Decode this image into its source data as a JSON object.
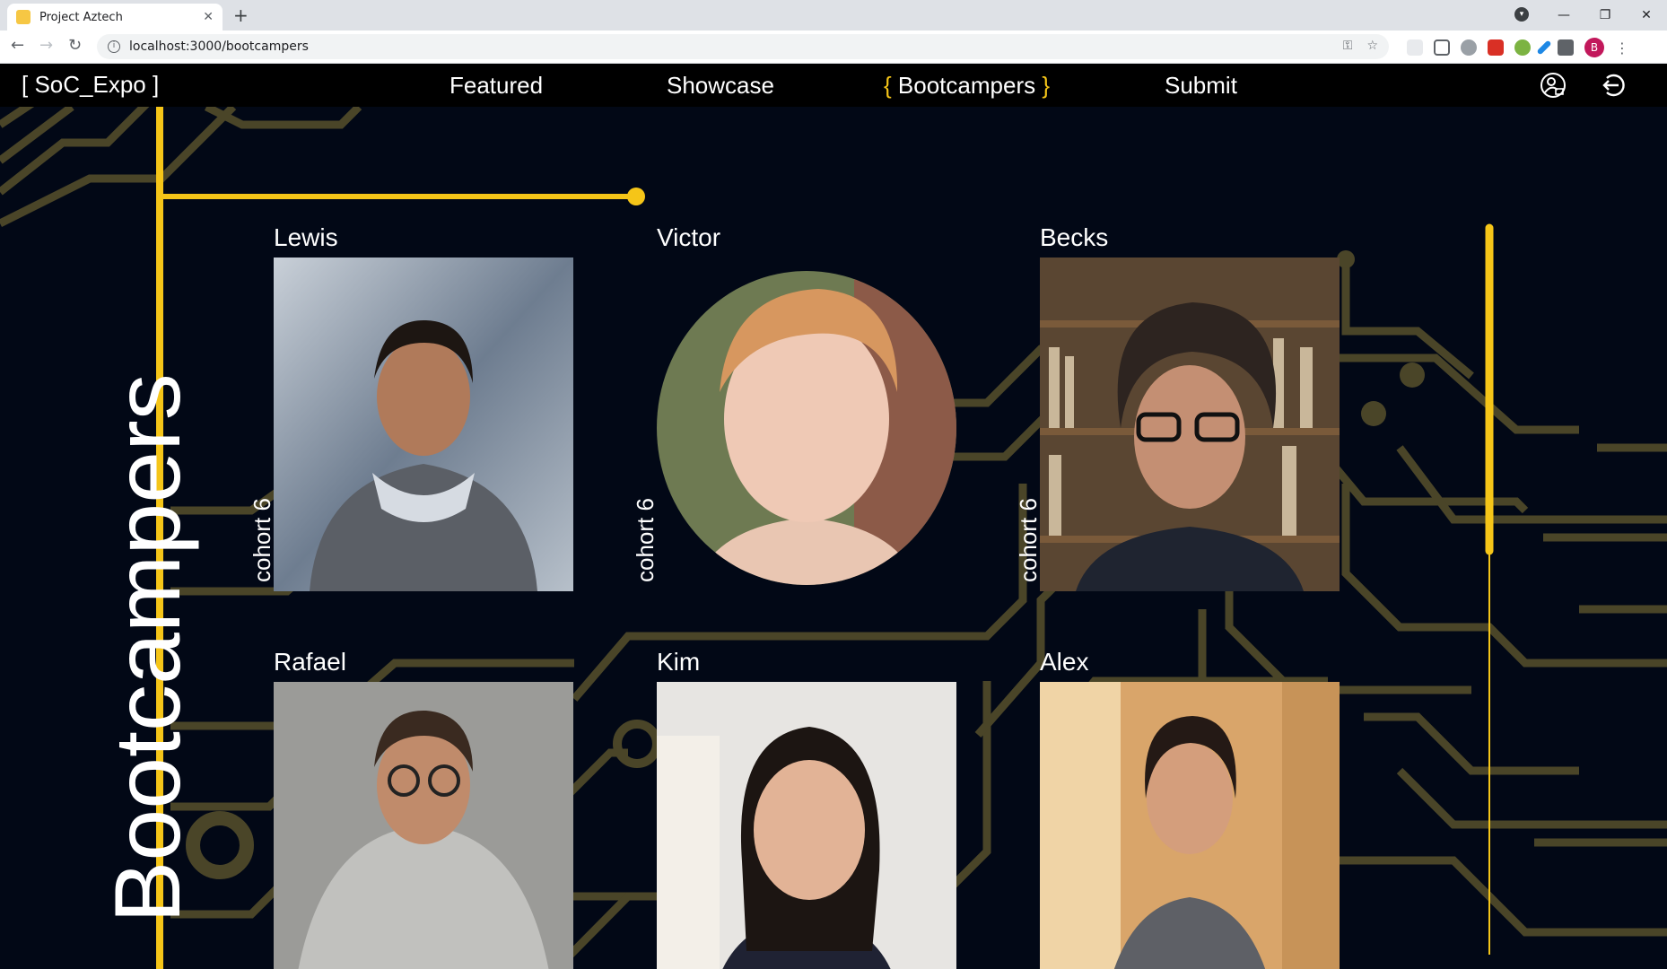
{
  "browser": {
    "tab_title": "Project Aztech",
    "url": "localhost:3000/bootcampers",
    "avatar_letter": "B"
  },
  "nav": {
    "logo": "[ SoC_Expo ]",
    "links": [
      "Featured",
      "Showcase",
      "Bootcampers",
      "Submit"
    ],
    "active": "Bootcampers",
    "icons": [
      "user-lock-icon",
      "logout-icon"
    ]
  },
  "page": {
    "title": "Bootcampers",
    "accent_color": "#f5c518",
    "background_color": "#020816",
    "circuit_color": "#4a4528"
  },
  "bootcampers": [
    {
      "name": "Lewis",
      "cohort": "cohort 6"
    },
    {
      "name": "Victor",
      "cohort": "cohort 6"
    },
    {
      "name": "Becks",
      "cohort": "cohort 6"
    },
    {
      "name": "Rafael",
      "cohort": ""
    },
    {
      "name": "Kim",
      "cohort": ""
    },
    {
      "name": "Alex",
      "cohort": ""
    }
  ]
}
